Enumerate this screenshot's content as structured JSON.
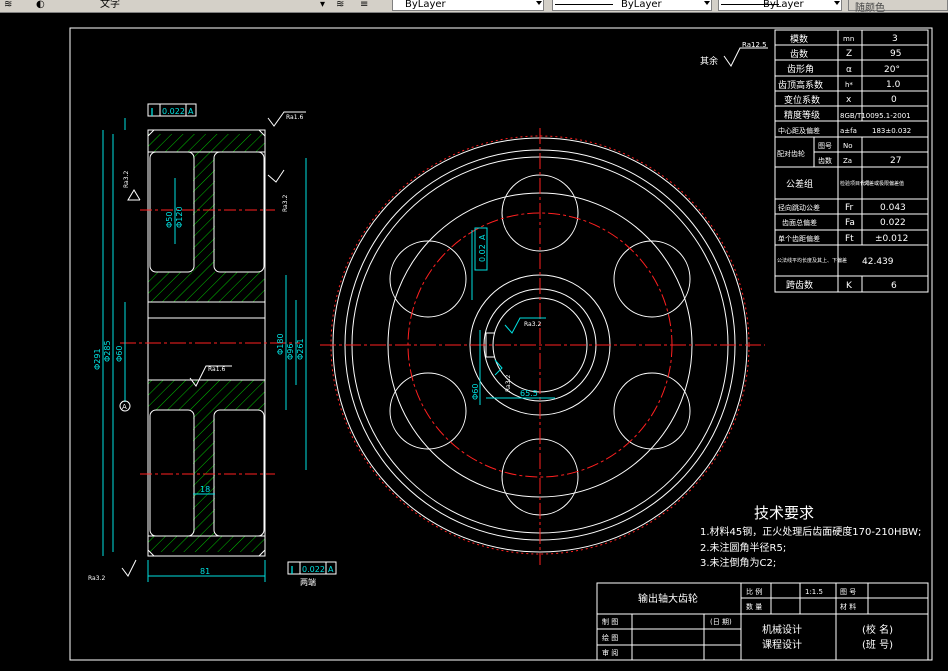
{
  "toolbar": {
    "text_style": "文字",
    "layer_select": "ByLayer",
    "linetype_select": "ByLayer",
    "lineweight_select": "ByLayer",
    "color_select": "随颜色"
  },
  "drawing": {
    "roughness_rest_label": "其余",
    "roughness_rest_value": "Ra12.5",
    "tol_top": "0.022",
    "tol_top_datum": "A",
    "tol_bottom": "0.022",
    "tol_bottom_datum": "A",
    "tol_side": "0.02",
    "tol_side_datum": "A",
    "both_ends": "两端",
    "dims": {
      "face_width": "81",
      "web": "18",
      "da": "Φ291",
      "d_root": "Φ285",
      "hub_bore": "Φ60",
      "hole1": "Φ50",
      "hole2": "Φ120",
      "hub": "Φ96",
      "rim_in": "Φ180",
      "rim_out": "Φ261",
      "ra16_top": "Ra1.6",
      "ra32_left": "Ra3.2",
      "ra32_right": "Ra3.2",
      "ra16_mid": "Ra1.6",
      "ra32_bottom": "Ra3.2",
      "ra32_key": "Ra3.2",
      "ra32_keyside": "Ra3.2",
      "keyway_depth": "65.5",
      "keyway_width": "18",
      "bore_side": "Φ60",
      "hole_count": "6xΦ"
    },
    "datum_a": "A"
  },
  "params": {
    "rows": [
      [
        "模数",
        "mn",
        "3"
      ],
      [
        "齿数",
        "Z",
        "95"
      ],
      [
        "齿形角",
        "α",
        "20°"
      ],
      [
        "齿顶高系数",
        "h*",
        "1.0"
      ],
      [
        "变位系数",
        "x",
        "0"
      ]
    ],
    "accuracy_label": "精度等级",
    "accuracy_value": "8GB/T10095.1-2001",
    "center_label": "中心距及偏差",
    "center_sym": "a±fa",
    "center_value": "183±0.032",
    "mate_label": "配对齿轮",
    "mate_drawing_label": "图号",
    "mate_drawing_sym": "No",
    "mate_teeth_label": "齿数",
    "mate_teeth_sym": "Za",
    "mate_teeth_value": "27",
    "tolgroup_label": "公差组",
    "tolgroup_sym": "检验项目代号",
    "tolgroup_value": "公差或极限偏差值",
    "fr_label": "径向跳动公差",
    "fr_sym": "Fr",
    "fr_value": "0.043",
    "fa_label": "齿面总偏差",
    "fa_sym": "Fa",
    "fa_value": "0.022",
    "ft_label": "单个齿距偏差",
    "ft_sym": "Ft",
    "ft_value": "±0.012",
    "wk_label": "公法线平均长度及其上、下偏差",
    "wk_value": "42.439",
    "k_label": "跨齿数",
    "k_sym": "K",
    "k_value": "6"
  },
  "tech": {
    "title": "技术要求",
    "line1": "1.材料45钢，正火处理后齿面硬度170-210HBW;",
    "line2": "2.未注圆角半径R5;",
    "line3": "3.未注倒角为C2;"
  },
  "title_block": {
    "part_name": "输出轴大齿轮",
    "scale_label": "比 例",
    "scale_value": "1:1.5",
    "drawing_no_label": "图 号",
    "qty_label": "数 量",
    "material_label": "材 料",
    "draw_label": "制 图",
    "check_label": "绘 图",
    "review_label": "审 阅",
    "date_label": "(日 期)",
    "course1": "机械设计",
    "course2": "课程设计",
    "school": "(校 名)",
    "class": "(班 号)"
  }
}
